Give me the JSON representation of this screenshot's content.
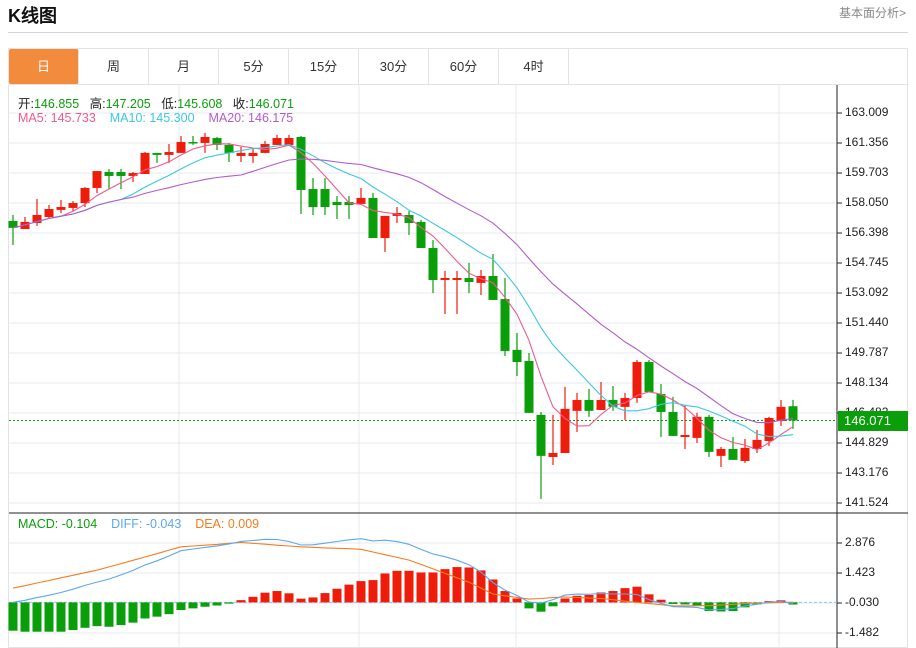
{
  "header": {
    "title": "K线图",
    "link": "基本面分析>"
  },
  "tabs": [
    {
      "label": "日",
      "active": true
    },
    {
      "label": "周"
    },
    {
      "label": "月"
    },
    {
      "label": "5分"
    },
    {
      "label": "15分"
    },
    {
      "label": "30分"
    },
    {
      "label": "60分"
    },
    {
      "label": "4时"
    }
  ],
  "quote": {
    "open_label": "开:",
    "open": "146.855",
    "high_label": "高:",
    "high": "147.205",
    "low_label": "低:",
    "low": "145.608",
    "close_label": "收:",
    "close": "146.071",
    "ma5": "MA5: 145.733",
    "ma10": "MA10: 145.300",
    "ma20": "MA20: 146.175",
    "last_price": "146.071"
  },
  "macd_legend": {
    "macd": "MACD: -0.104",
    "diff": "DIFF: -0.043",
    "dea": "DEA: 0.009"
  },
  "colors": {
    "up": "#ee1c0b",
    "down": "#0a9e0a",
    "accent": "#f28b3c",
    "ma5": "#ef5b8c",
    "ma10": "#3cc8e0",
    "ma20": "#b25ccb",
    "diff": "#5aa9f0",
    "dea": "#f57c1f"
  },
  "chart_data": [
    {
      "type": "candlestick",
      "title": "K线图",
      "price_ticks": [
        "163.009",
        "161.356",
        "159.703",
        "158.050",
        "156.398",
        "154.745",
        "153.092",
        "151.440",
        "149.787",
        "148.134",
        "146.482",
        "144.829",
        "143.176",
        "141.524"
      ],
      "ylim": [
        141.524,
        163.009
      ],
      "ohlc": [
        [
          157.06,
          157.39,
          155.74,
          156.68
        ],
        [
          156.62,
          157.28,
          156.62,
          157.01
        ],
        [
          156.95,
          158.27,
          156.79,
          157.39
        ],
        [
          157.28,
          157.94,
          157.17,
          157.72
        ],
        [
          157.67,
          158.22,
          157.5,
          157.83
        ],
        [
          157.78,
          158.16,
          157.61,
          158.05
        ],
        [
          158.05,
          158.93,
          157.83,
          158.88
        ],
        [
          158.88,
          159.81,
          158.6,
          159.81
        ],
        [
          159.76,
          159.92,
          158.82,
          159.54
        ],
        [
          159.76,
          159.92,
          158.82,
          159.54
        ],
        [
          159.54,
          159.76,
          159.21,
          159.7
        ],
        [
          159.65,
          160.86,
          159.65,
          160.81
        ],
        [
          160.81,
          160.81,
          160.26,
          160.7
        ],
        [
          160.7,
          161.3,
          160.26,
          160.86
        ],
        [
          160.81,
          161.74,
          160.81,
          161.41
        ],
        [
          161.41,
          161.74,
          161.25,
          161.36
        ],
        [
          161.36,
          161.91,
          160.81,
          161.69
        ],
        [
          161.63,
          161.69,
          160.97,
          161.25
        ],
        [
          161.25,
          161.36,
          160.31,
          160.81
        ],
        [
          160.64,
          161.14,
          160.31,
          160.81
        ],
        [
          160.64,
          161.08,
          160.26,
          160.81
        ],
        [
          160.81,
          161.47,
          160.81,
          161.3
        ],
        [
          161.25,
          161.8,
          161.25,
          161.63
        ],
        [
          161.25,
          161.8,
          161.25,
          161.63
        ],
        [
          161.69,
          161.74,
          157.45,
          158.77
        ],
        [
          158.82,
          159.43,
          157.39,
          157.83
        ],
        [
          158.82,
          159.43,
          157.39,
          157.83
        ],
        [
          158.11,
          158.44,
          157.17,
          157.94
        ],
        [
          158.11,
          158.44,
          157.17,
          157.94
        ],
        [
          158.0,
          158.88,
          158.0,
          158.33
        ],
        [
          158.33,
          158.6,
          156.12,
          156.12
        ],
        [
          156.12,
          157.34,
          155.35,
          157.34
        ],
        [
          157.34,
          157.83,
          156.95,
          157.5
        ],
        [
          157.39,
          157.61,
          156.29,
          156.95
        ],
        [
          157.01,
          157.12,
          155.57,
          155.57
        ],
        [
          155.57,
          156.01,
          153.09,
          153.81
        ],
        [
          153.81,
          154.31,
          151.94,
          153.92
        ],
        [
          153.81,
          154.31,
          151.94,
          153.92
        ],
        [
          153.92,
          154.75,
          153.09,
          153.7
        ],
        [
          153.65,
          154.36,
          152.98,
          154.03
        ],
        [
          154.03,
          155.24,
          152.71,
          152.71
        ],
        [
          152.76,
          153.92,
          149.62,
          149.9
        ],
        [
          149.96,
          150.89,
          148.52,
          149.29
        ],
        [
          149.35,
          149.79,
          146.49,
          146.49
        ],
        [
          146.38,
          146.54,
          141.75,
          144.12
        ],
        [
          144.06,
          146.38,
          143.62,
          144.28
        ],
        [
          144.28,
          147.92,
          144.28,
          146.71
        ],
        [
          146.6,
          147.59,
          145.44,
          147.2
        ],
        [
          147.2,
          147.81,
          146.27,
          146.6
        ],
        [
          146.65,
          148.19,
          146.65,
          147.2
        ],
        [
          147.2,
          147.97,
          146.6,
          146.82
        ],
        [
          146.82,
          147.59,
          146.1,
          147.31
        ],
        [
          147.31,
          149.4,
          147.04,
          149.29
        ],
        [
          149.29,
          149.4,
          147.64,
          147.64
        ],
        [
          147.53,
          148.08,
          145.16,
          146.54
        ],
        [
          146.54,
          147.37,
          145.22,
          145.22
        ],
        [
          145.16,
          146.93,
          144.5,
          145.27
        ],
        [
          145.11,
          146.49,
          144.83,
          146.27
        ],
        [
          146.27,
          146.38,
          144.06,
          144.34
        ],
        [
          144.12,
          144.61,
          143.51,
          144.5
        ],
        [
          144.5,
          145.16,
          143.9,
          143.9
        ],
        [
          143.84,
          145.05,
          143.73,
          144.56
        ],
        [
          144.5,
          145.55,
          144.28,
          145.0
        ],
        [
          144.94,
          146.27,
          144.67,
          146.21
        ],
        [
          146.04,
          147.2,
          145.77,
          146.82
        ],
        [
          146.855,
          147.205,
          145.608,
          146.071
        ]
      ],
      "moving_averages": [
        5,
        10,
        20
      ],
      "last_price": 146.071
    },
    {
      "type": "bar+line",
      "title": "MACD",
      "ticks": [
        "2.876",
        "1.423",
        "-0.030",
        "-1.482"
      ],
      "ylim": [
        -1.482,
        2.876
      ],
      "macd": [
        -1.37,
        -1.42,
        -1.42,
        -1.42,
        -1.42,
        -1.34,
        -1.23,
        -1.15,
        -1.18,
        -1.1,
        -0.98,
        -0.78,
        -0.69,
        -0.57,
        -0.37,
        -0.29,
        -0.21,
        -0.15,
        -0.06,
        0.11,
        0.27,
        0.47,
        0.55,
        0.44,
        0.18,
        0.24,
        0.45,
        0.66,
        0.86,
        1.03,
        1.08,
        1.4,
        1.53,
        1.53,
        1.45,
        1.45,
        1.61,
        1.71,
        1.69,
        1.55,
        1.11,
        0.55,
        0.19,
        -0.29,
        -0.45,
        -0.19,
        0.19,
        0.32,
        0.36,
        0.48,
        0.55,
        0.69,
        0.76,
        0.39,
        0.13,
        -0.08,
        -0.1,
        -0.16,
        -0.42,
        -0.44,
        -0.42,
        -0.24,
        -0.1,
        0.06,
        0.1,
        -0.104
      ],
      "dea": [
        0.69,
        0.81,
        0.94,
        1.06,
        1.19,
        1.31,
        1.44,
        1.56,
        1.72,
        1.88,
        2.04,
        2.2,
        2.36,
        2.53,
        2.69,
        2.73,
        2.77,
        2.81,
        2.86,
        2.9,
        2.86,
        2.82,
        2.77,
        2.73,
        2.69,
        2.67,
        2.64,
        2.62,
        2.6,
        2.57,
        2.44,
        2.31,
        2.18,
        2.05,
        1.84,
        1.62,
        1.41,
        1.19,
        0.98,
        0.69,
        0.4,
        0.32,
        0.24,
        0.16,
        0.19,
        0.23,
        0.26,
        0.24,
        0.21,
        0.19,
        0.13,
        0.06,
        0.0,
        -0.06,
        -0.11,
        -0.17,
        -0.17,
        -0.16,
        -0.16,
        -0.12,
        -0.09,
        -0.05,
        -0.04,
        -0.02,
        -0.01,
        0.009
      ]
    }
  ]
}
